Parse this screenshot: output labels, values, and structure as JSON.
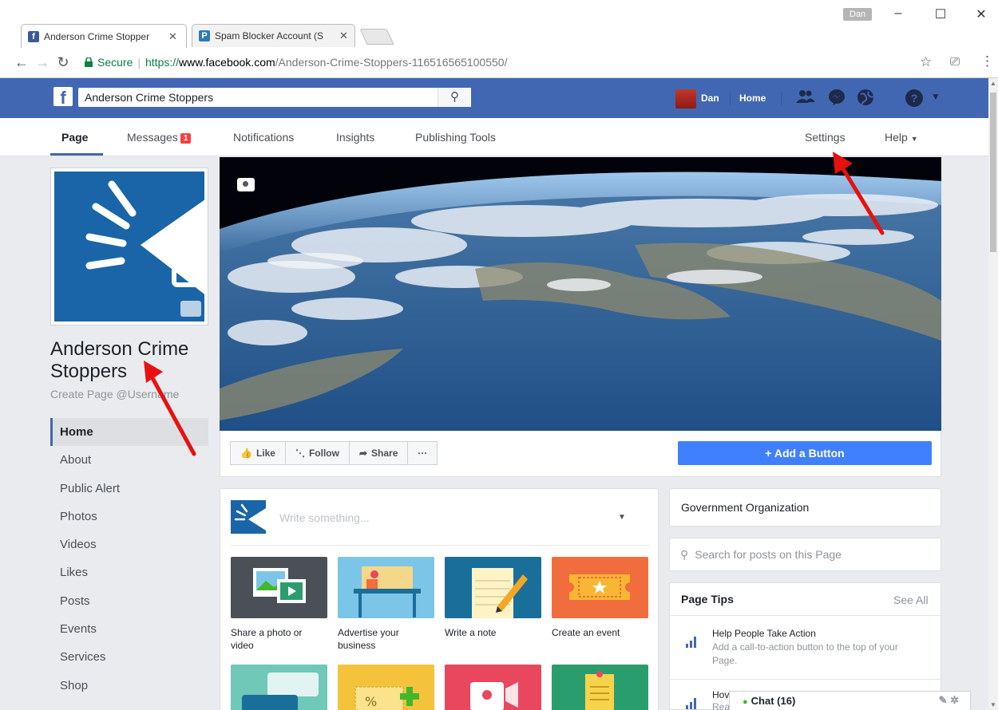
{
  "browser": {
    "tabs": [
      {
        "title": "Anderson Crime Stopper",
        "icon": "facebook-favicon"
      },
      {
        "title": "Spam Blocker Account (S",
        "icon": "p-favicon"
      }
    ],
    "profile_name": "Dan",
    "secure_label": "Secure",
    "url_scheme": "https://",
    "url_host": "www.facebook.com",
    "url_path": "/Anderson-Crime-Stoppers-116516565100550/"
  },
  "fb_header": {
    "search_value": "Anderson Crime Stoppers",
    "user_name": "Dan",
    "home_label": "Home"
  },
  "page_nav": {
    "items": [
      "Page",
      "Messages",
      "Notifications",
      "Insights",
      "Publishing Tools",
      "Settings",
      "Help"
    ],
    "messages_badge": "1"
  },
  "profile": {
    "name": "Anderson Crime Stoppers",
    "username_prompt": "Create Page @Username"
  },
  "left_nav": [
    "Home",
    "About",
    "Public Alert",
    "Photos",
    "Videos",
    "Likes",
    "Posts",
    "Events",
    "Services",
    "Shop"
  ],
  "actions": {
    "like": "Like",
    "follow": "Follow",
    "share": "Share",
    "more": "···",
    "add_button": "+ Add a Button"
  },
  "composer": {
    "placeholder": "Write something...",
    "tiles": [
      {
        "label": "Share a photo or video",
        "color": "#4b4f56"
      },
      {
        "label": "Advertise your business",
        "color": "#7bc6e8"
      },
      {
        "label": "Write a note",
        "color": "#1a6e9a"
      },
      {
        "label": "Create an event",
        "color": "#f26d3d"
      }
    ],
    "tiles_row2_colors": [
      "#6fc8b8",
      "#f5c33b",
      "#e8475e",
      "#2a9d6f"
    ]
  },
  "sidebar": {
    "category": "Government Organization",
    "search_placeholder": "Search for posts on this Page",
    "tips_title": "Page Tips",
    "see_all": "See All",
    "tips": [
      {
        "title": "Help People Take Action",
        "desc": "Add a call-to-action button to the top of your Page."
      },
      {
        "title": "Hov",
        "desc": "Rea"
      }
    ]
  },
  "chat": {
    "label": "Chat (16)"
  },
  "colors": {
    "fb_blue": "#4267b2",
    "button_blue": "#4080ff",
    "badge_red": "#fa3e3e",
    "annotation_red": "#e8110f"
  }
}
